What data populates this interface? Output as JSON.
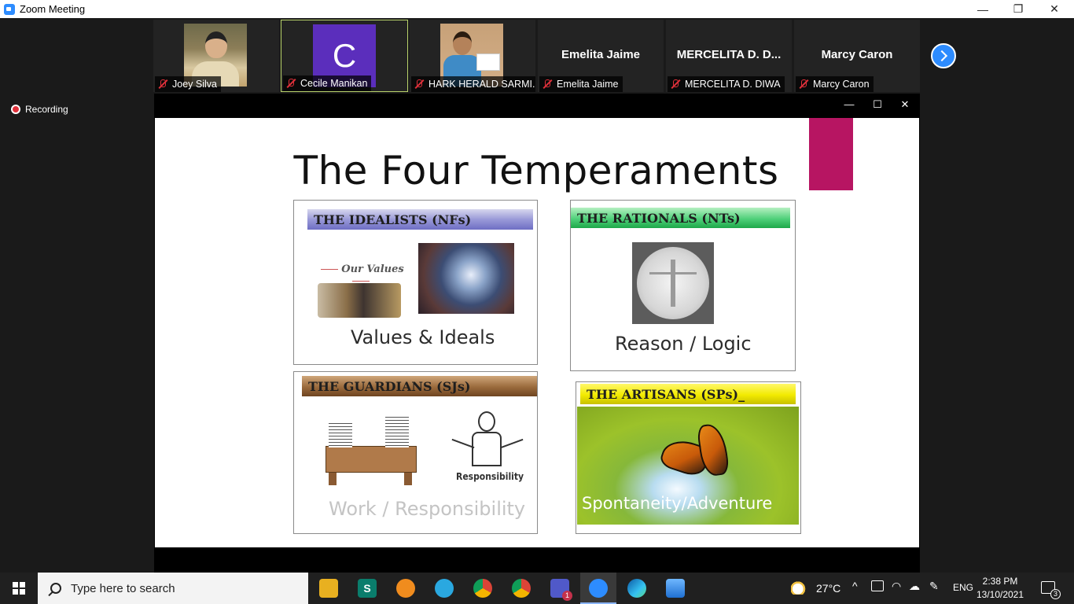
{
  "window": {
    "title": "Zoom Meeting",
    "minimize": "—",
    "restore": "❐",
    "close": "✕"
  },
  "participants": [
    {
      "label": "Joey Silva",
      "display": "photo"
    },
    {
      "label": "Cecile Manikan",
      "display": "avatar",
      "initial": "C",
      "active": true
    },
    {
      "label": "HARK HERALD SARMI...",
      "display": "photo"
    },
    {
      "label": "Emelita Jaime",
      "display": "name",
      "tile_name": "Emelita Jaime"
    },
    {
      "label": "MERCELITA D. DIWA",
      "display": "name",
      "tile_name": "MERCELITA  D.  D..."
    },
    {
      "label": "Marcy Caron",
      "display": "name",
      "tile_name": "Marcy Caron"
    }
  ],
  "recording": {
    "label": "Recording"
  },
  "share_window": {
    "minimize": "—",
    "maximize": "☐",
    "close": "✕"
  },
  "slide": {
    "title": "The Four Temperaments",
    "accent_color": "#b71562",
    "quadrants": {
      "idealists": {
        "heading": "THE IDEALISTS (NFs)",
        "caption": "Values & Ideals",
        "image_text": "Our Values"
      },
      "rationals": {
        "heading": "THE RATIONALS  (NTs)",
        "caption": "Reason / Logic"
      },
      "guardians": {
        "heading": "THE GUARDIANS  (SJs)",
        "caption": "Work / Responsibility",
        "image_text": "Responsibility"
      },
      "artisans": {
        "heading": "THE ARTISANS (SPs)_",
        "caption": "Spontaneity/Adventure"
      }
    }
  },
  "taskbar": {
    "search_placeholder": "Type here to search",
    "temperature": "27°C",
    "language": "ENG",
    "time": "2:38 PM",
    "date": "13/10/2021",
    "notifications_count": "3",
    "teams_badge": "1"
  }
}
